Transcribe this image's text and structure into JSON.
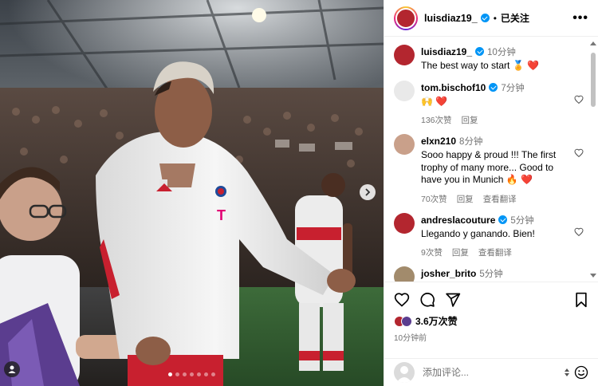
{
  "post": {
    "username": "luisdiaz19_",
    "separator": "•",
    "follow_state": "已关注",
    "more_icon": "more-horizontal-icon",
    "photo_dot_count": 7,
    "active_dot": 0,
    "caption": {
      "username": "luisdiaz19_",
      "time": "10分钟",
      "text": "The best way to start 🏅 ❤️"
    },
    "comments": [
      {
        "username": "tom.bischof10",
        "verified": true,
        "time": "7分钟",
        "text": "🙌 ❤️",
        "likes": "136次赞",
        "reply": "回复",
        "translate": ""
      },
      {
        "username": "elxn210",
        "verified": false,
        "time": "8分钟",
        "text": "Sooo happy & proud !!! The first trophy of many more... Good to have you in Munich 🔥 ❤️",
        "likes": "70次赞",
        "reply": "回复",
        "translate": "查看翻译"
      },
      {
        "username": "andreslacouture",
        "verified": true,
        "time": "5分钟",
        "text": "Llegando y ganando. Bien!",
        "likes": "9次赞",
        "reply": "回复",
        "translate": "查看翻译"
      },
      {
        "username": "josher_brito",
        "verified": false,
        "time": "5分钟",
        "text": "",
        "likes": "",
        "reply": "",
        "translate": ""
      }
    ],
    "like_count": "3.6万次赞",
    "posted_ago": "10分钟前",
    "comment_placeholder": "添加评论..."
  },
  "colors": {
    "verified": "#0095f6",
    "heart": "#ed4956",
    "muted": "#737373"
  }
}
